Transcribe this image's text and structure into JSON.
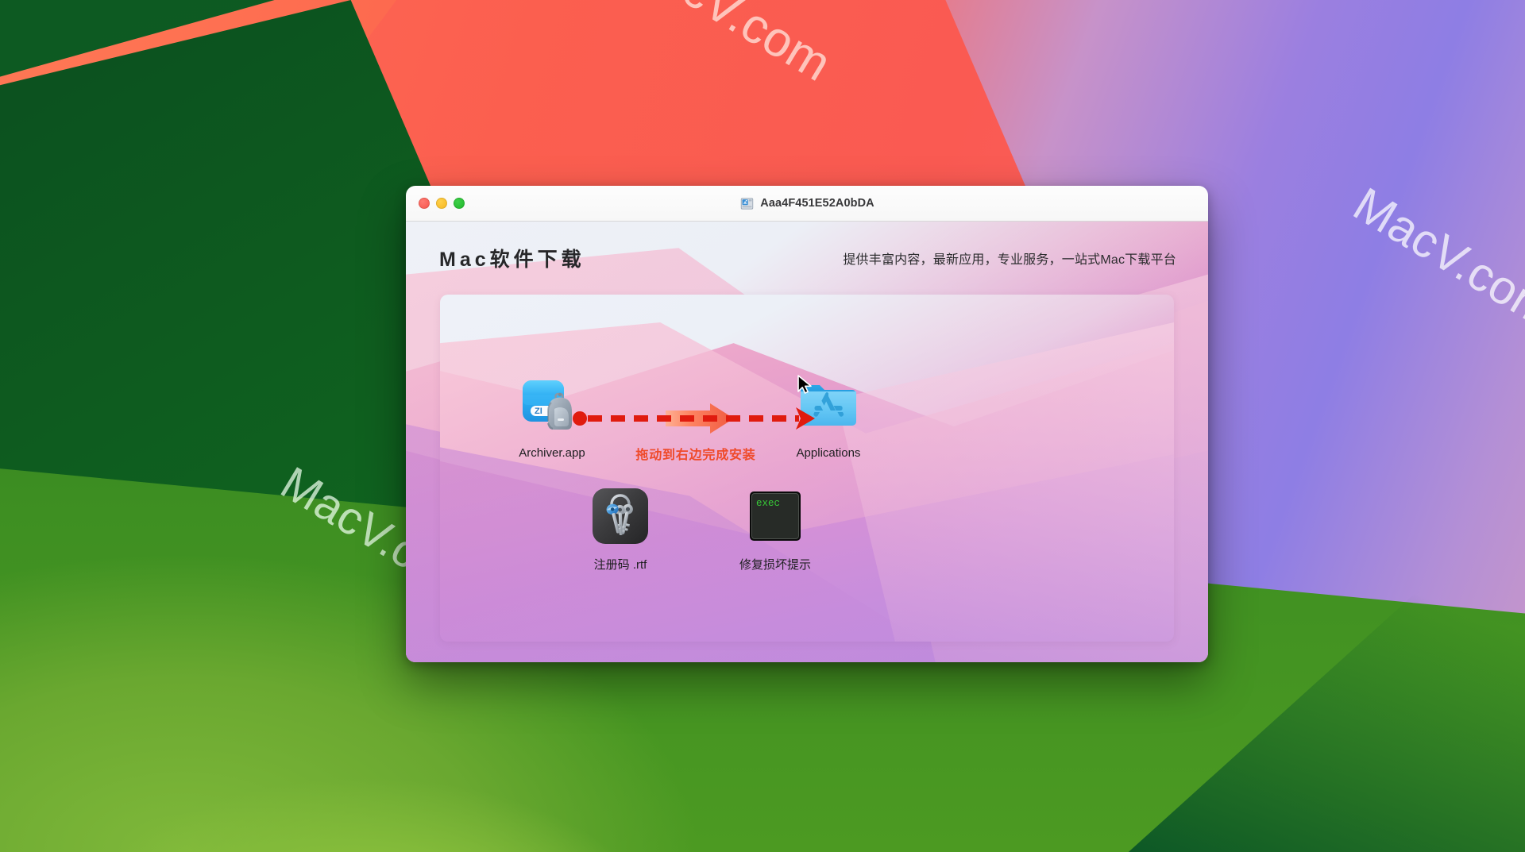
{
  "desktop": {
    "watermarks": [
      {
        "id": "wm-top",
        "text": "MacV.com"
      },
      {
        "id": "wm-right",
        "text": "MacV.com"
      },
      {
        "id": "wm-left",
        "text": "MacV.com"
      }
    ]
  },
  "window": {
    "title": "Aaa4F451E52A0bDA",
    "disk_icon": "disk-drive-icon",
    "traffic_lights": {
      "close": "close-button",
      "minimize": "minimize-button",
      "zoom": "zoom-button"
    }
  },
  "header": {
    "brand_title": "Mac软件下载",
    "tagline": "提供丰富内容，最新应用，专业服务，一站式Mac下载平台"
  },
  "install_hint": {
    "caption": "拖动到右边完成安装",
    "caption_color": "#ef4a2a",
    "arrow_color": "#e01b0e",
    "arrow_gradient_from": "#ff8a5c",
    "arrow_gradient_to": "#f0402c"
  },
  "icons": [
    {
      "id": "archiver",
      "label": "Archiver.app",
      "icon_name": "archiver-app-icon",
      "badge_text": "ZI",
      "accent": "#29a9f0"
    },
    {
      "id": "applications",
      "label": "Applications",
      "icon_name": "applications-folder-icon",
      "accent": "#5ec6f5"
    },
    {
      "id": "rtf",
      "label": "注册码 .rtf",
      "icon_name": "keychain-rtf-icon",
      "accent": "#3b3b3d"
    },
    {
      "id": "exec",
      "label": "修复损坏提示",
      "icon_name": "terminal-exec-icon",
      "terminal_text": "exec",
      "accent": "#1d1d1f",
      "text_color": "#37c837"
    }
  ]
}
